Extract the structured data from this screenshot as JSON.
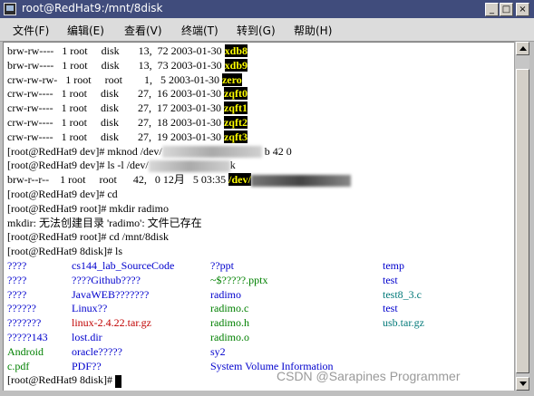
{
  "window": {
    "title": "root@RedHat9:/mnt/8disk",
    "buttons": [
      "_",
      "□",
      "×"
    ]
  },
  "menu": [
    "文件(F)",
    "编辑(E)",
    "查看(V)",
    "终端(T)",
    "转到(G)",
    "帮助(H)"
  ],
  "terminal": {
    "ls_devices": [
      {
        "perm": "brw-rw----",
        "links": "1",
        "owner": "root",
        "group": "disk",
        "major": "13,",
        "minor": "72",
        "date": "2003-01-30",
        "name": "xdb8"
      },
      {
        "perm": "brw-rw----",
        "links": "1",
        "owner": "root",
        "group": "disk",
        "major": "13,",
        "minor": "73",
        "date": "2003-01-30",
        "name": "xdb9"
      },
      {
        "perm": "crw-rw-rw-",
        "links": "1",
        "owner": "root",
        "group": "root",
        "major": "1,",
        "minor": "5",
        "date": "2003-01-30",
        "name": "zero"
      },
      {
        "perm": "crw-rw----",
        "links": "1",
        "owner": "root",
        "group": "disk",
        "major": "27,",
        "minor": "16",
        "date": "2003-01-30",
        "name": "zqft0"
      },
      {
        "perm": "crw-rw----",
        "links": "1",
        "owner": "root",
        "group": "disk",
        "major": "27,",
        "minor": "17",
        "date": "2003-01-30",
        "name": "zqft1"
      },
      {
        "perm": "crw-rw----",
        "links": "1",
        "owner": "root",
        "group": "disk",
        "major": "27,",
        "minor": "18",
        "date": "2003-01-30",
        "name": "zqft2"
      },
      {
        "perm": "crw-rw----",
        "links": "1",
        "owner": "root",
        "group": "disk",
        "major": "27,",
        "minor": "19",
        "date": "2003-01-30",
        "name": "zqft3"
      }
    ],
    "mknod_prompt": "[root@RedHat9 dev]# mknod /dev/",
    "mknod_suffix": " b 42 0",
    "ls_prompt": "[root@RedHat9 dev]# ls -l /dev/",
    "ls_suffix": "k",
    "ls_result_prefix": "brw-r--r--    1 root     root      42,   0 12月   5 03:35 ",
    "ls_result_name": "/dev/",
    "cd_line": "[root@RedHat9 dev]# cd",
    "mkdir_line": "[root@RedHat9 root]# mkdir radimo",
    "mkdir_error": "mkdir: 无法创建目录 'radimo': 文件已存在",
    "cd_mnt_line": "[root@RedHat9 root]# cd /mnt/8disk",
    "ls_8disk_line": "[root@RedHat9 8disk]# ls",
    "files": [
      [
        "????",
        "cs144_lab_SourceCode",
        "??ppt",
        "temp"
      ],
      [
        "????",
        "????Github????",
        "~$?????.pptx",
        "test"
      ],
      [
        "????",
        "JavaWEB???????",
        "radimo",
        "test8_3.c"
      ],
      [
        "??????",
        "Linux??",
        "radimo.c",
        "test"
      ],
      [
        "???????",
        "linux-2.4.22.tar.gz",
        "radimo.h",
        "usb.tar.gz"
      ],
      [
        "?????143",
        "lost.dir",
        "radimo.o",
        ""
      ],
      [
        "Android",
        "oracle?????",
        "sy2",
        ""
      ],
      [
        "c.pdf",
        "PDF??",
        "System Volume Information",
        ""
      ]
    ],
    "last_prompt": "[root@RedHat9 8disk]# "
  },
  "watermark": "CSDN @Sarapines Programmer"
}
